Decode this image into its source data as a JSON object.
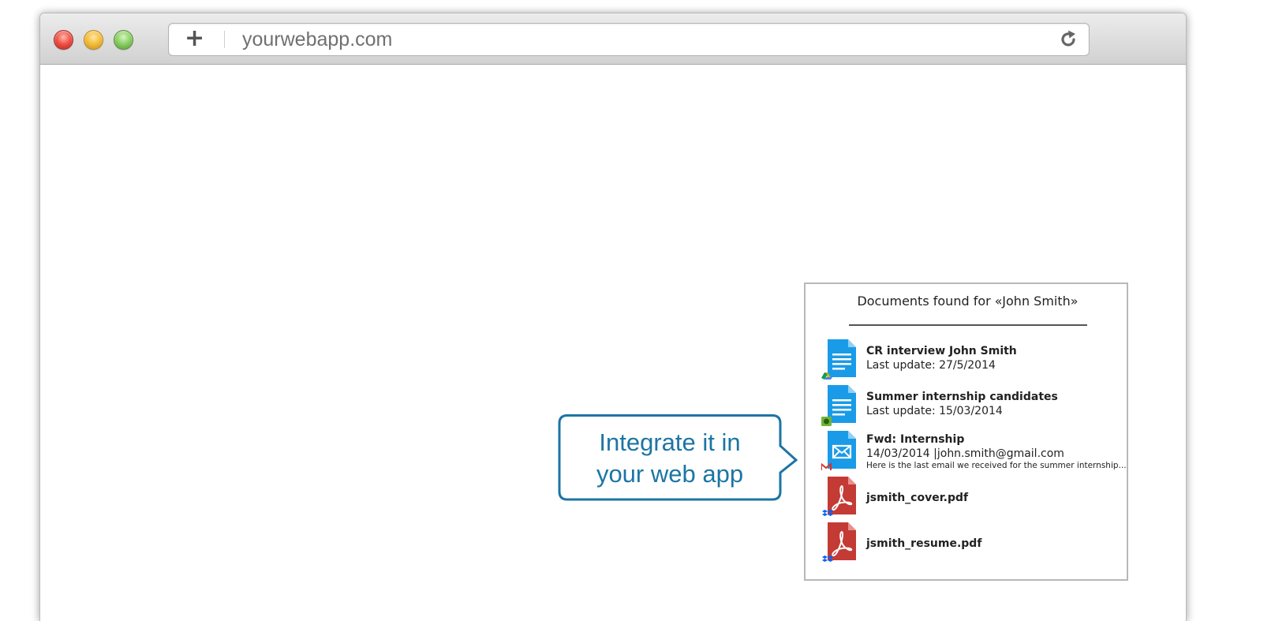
{
  "browser": {
    "url": "yourwebapp.com",
    "new_tab_label": "+"
  },
  "callout": {
    "line1": "Integrate it in",
    "line2": "your web app",
    "color": "#1c75a4"
  },
  "panel": {
    "title": "Documents found for «John Smith»",
    "items": [
      {
        "title": "CR interview John Smith",
        "subtitle": "Last update: 27/5/2014",
        "icon": "document-icon",
        "source": "google-drive-icon"
      },
      {
        "title": "Summer internship candidates",
        "subtitle": "Last update: 15/03/2014",
        "icon": "document-icon",
        "source": "evernote-icon"
      },
      {
        "title": "Fwd: Internship",
        "subtitle": "14/03/2014 |john.smith@gmail.com",
        "snippet": "Here is the last email we received for the summer internship...",
        "icon": "email-icon",
        "source": "gmail-icon"
      },
      {
        "title": "jsmith_cover.pdf",
        "icon": "pdf-icon",
        "source": "dropbox-icon"
      },
      {
        "title": "jsmith_resume.pdf",
        "icon": "pdf-icon",
        "source": "dropbox-icon"
      }
    ]
  }
}
